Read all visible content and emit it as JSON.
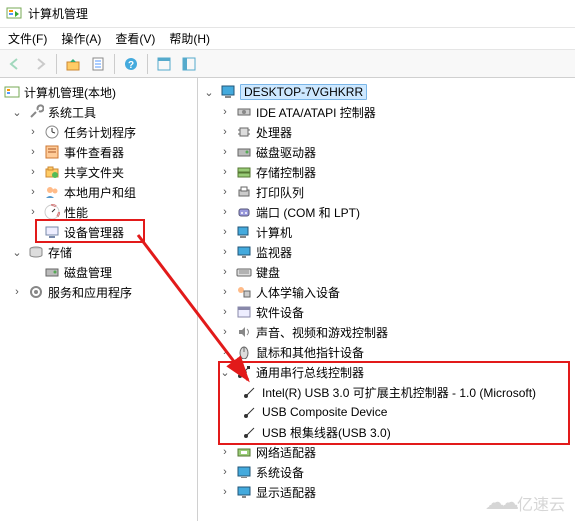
{
  "title": "计算机管理",
  "menus": {
    "file": "文件(F)",
    "action": "操作(A)",
    "view": "查看(V)",
    "help": "帮助(H)"
  },
  "left": {
    "root": "计算机管理(本地)",
    "systools": "系统工具",
    "task": "任务计划程序",
    "event": "事件查看器",
    "share": "共享文件夹",
    "users": "本地用户和组",
    "perf": "性能",
    "devmgr": "设备管理器",
    "storage": "存储",
    "disk": "磁盘管理",
    "services": "服务和应用程序"
  },
  "right": {
    "host": "DESKTOP-7VGHKRR",
    "ide": "IDE ATA/ATAPI 控制器",
    "cpu": "处理器",
    "diskdrive": "磁盘驱动器",
    "storagectl": "存储控制器",
    "printq": "打印队列",
    "ports": "端口 (COM 和 LPT)",
    "computer": "计算机",
    "monitor": "监视器",
    "keyboard": "键盘",
    "hid": "人体学输入设备",
    "software": "软件设备",
    "soundvid": "声音、视频和游戏控制器",
    "mouse": "鼠标和其他指针设备",
    "usb": "通用串行总线控制器",
    "usb1": "Intel(R) USB 3.0 可扩展主机控制器 - 1.0 (Microsoft)",
    "usb2": "USB Composite Device",
    "usb3": "USB 根集线器(USB 3.0)",
    "net": "网络适配器",
    "sysdev": "系统设备",
    "display": "显示适配器"
  },
  "watermark": "亿速云"
}
